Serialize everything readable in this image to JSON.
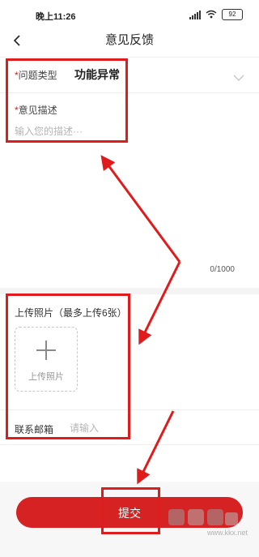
{
  "status_bar": {
    "time": "晚上11:26",
    "battery": "92"
  },
  "header": {
    "title": "意见反馈"
  },
  "form": {
    "issue_type": {
      "required_mark": "*",
      "label": "问题类型",
      "value": "功能异常"
    },
    "description": {
      "required_mark": "*",
      "label": "意见描述",
      "placeholder": "输入您的描述···",
      "char_count": "0/1000"
    },
    "upload": {
      "title": "上传照片（最多上传6张）",
      "button_label": "上传照片"
    },
    "email": {
      "label": "联系邮箱",
      "placeholder": "请输入"
    }
  },
  "submit": {
    "label": "提交"
  },
  "watermark": {
    "url": "www.kkx.net"
  },
  "colors": {
    "accent": "#d62222",
    "annotation": "#e01b1b"
  },
  "icons": [
    "back-arrow-icon",
    "chevron-down-icon",
    "plus-icon",
    "signal-icon",
    "wifi-icon",
    "battery-icon"
  ]
}
